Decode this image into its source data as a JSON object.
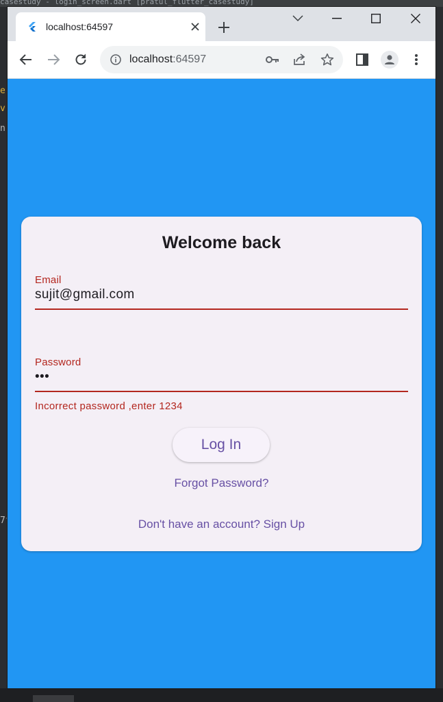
{
  "background": {
    "ide_title": "casestudy - login_screen.dart [pratul_flutter_casestudy]"
  },
  "browser": {
    "tab": {
      "title": "localhost:64597"
    },
    "address": {
      "host": "localhost",
      "port": ":64597"
    }
  },
  "page": {
    "title": "Welcome back",
    "email": {
      "label": "Email",
      "value": "sujit@gmail.com"
    },
    "password": {
      "label": "Password",
      "value": "•••",
      "error": "Incorrect password ,enter 1234"
    },
    "login_button": "Log In",
    "forgot_password": "Forgot Password?",
    "signup_prompt": "Don't have an account? Sign Up"
  },
  "colors": {
    "page_background": "#2196f3",
    "card_background": "#f4eff6",
    "error": "#b3261e",
    "accent": "#6750a4"
  },
  "icons": [
    "flutter-favicon",
    "close-icon",
    "plus-icon",
    "chevron-down-icon",
    "minimize-icon",
    "maximize-icon",
    "window-close-icon",
    "back-arrow-icon",
    "forward-arrow-icon",
    "reload-icon",
    "info-icon",
    "key-icon",
    "share-icon",
    "star-icon",
    "side-panel-icon",
    "profile-icon",
    "more-vert-icon"
  ]
}
